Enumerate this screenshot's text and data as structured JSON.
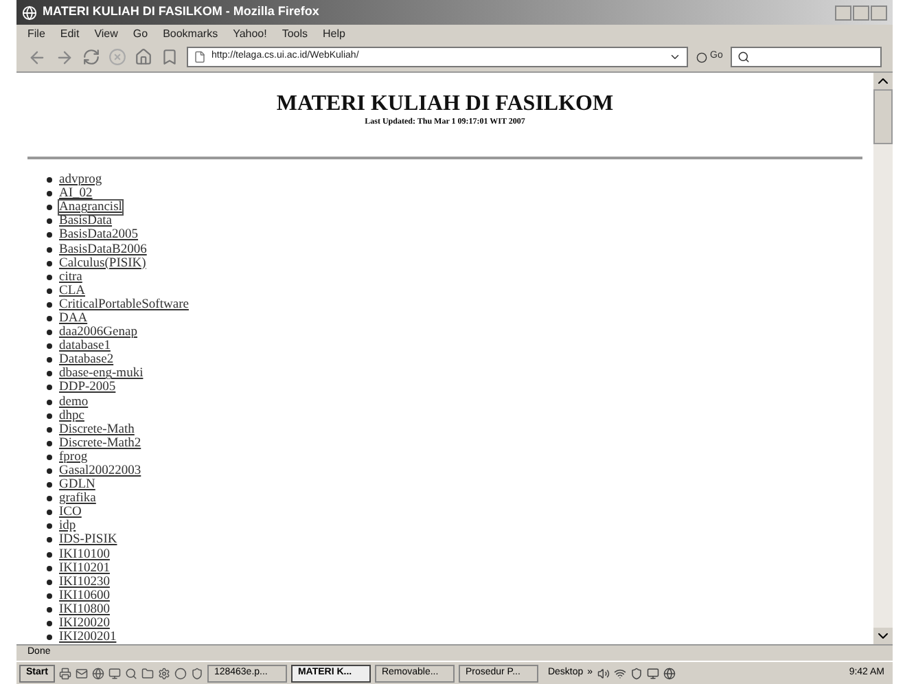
{
  "window": {
    "title": "MATERI KULIAH DI FASILKOM - Mozilla Firefox"
  },
  "menu": [
    "File",
    "Edit",
    "View",
    "Go",
    "Bookmarks",
    "Yahoo!",
    "Tools",
    "Help"
  ],
  "address": {
    "value": "http://telaga.cs.ui.ac.id/WebKuliah/"
  },
  "go_button": "Go",
  "page": {
    "heading": "MATERI KULIAH DI FASILKOM",
    "updated": "Last Updated: Thu Mar 1 09:17:01 WIT 2007",
    "links": [
      {
        "label": "advprog",
        "focused": false
      },
      {
        "label": "AI_02",
        "focused": false
      },
      {
        "label": "Anagrancisl",
        "focused": true
      },
      {
        "label": "BasisData",
        "focused": false
      },
      {
        "label": "BasisData2005",
        "focused": false
      },
      {
        "label": "BasisDataB2006",
        "focused": false
      },
      {
        "label": "Calculus(PISIK)",
        "focused": false
      },
      {
        "label": "citra",
        "focused": false
      },
      {
        "label": "CLA",
        "focused": false
      },
      {
        "label": "CriticalPortableSoftware",
        "focused": false
      },
      {
        "label": "DAA",
        "focused": false
      },
      {
        "label": "daa2006Genap",
        "focused": false
      },
      {
        "label": "database1",
        "focused": false
      },
      {
        "label": "Database2",
        "focused": false
      },
      {
        "label": "dbase-eng-muki",
        "focused": false
      },
      {
        "label": "DDP-2005",
        "focused": false
      },
      {
        "label": "demo",
        "focused": false
      },
      {
        "label": "dhpc",
        "focused": false
      },
      {
        "label": "Discrete-Math",
        "focused": false
      },
      {
        "label": "Discrete-Math2",
        "focused": false
      },
      {
        "label": "fprog",
        "focused": false
      },
      {
        "label": "Gasal20022003",
        "focused": false
      },
      {
        "label": "GDLN",
        "focused": false
      },
      {
        "label": "grafika",
        "focused": false
      },
      {
        "label": "ICO",
        "focused": false
      },
      {
        "label": "idp",
        "focused": false
      },
      {
        "label": "IDS-PISIK",
        "focused": false
      },
      {
        "label": "IKI10100",
        "focused": false
      },
      {
        "label": "IKI10201",
        "focused": false
      },
      {
        "label": "IKI10230",
        "focused": false
      },
      {
        "label": "IKI10600",
        "focused": false
      },
      {
        "label": "IKI10800",
        "focused": false
      },
      {
        "label": "IKI20020",
        "focused": false
      },
      {
        "label": "IKI200201",
        "focused": false
      }
    ]
  },
  "status_bar": "Done",
  "taskbar": {
    "start": "Start",
    "windows": [
      {
        "label": "128463e.p...",
        "selected": false
      },
      {
        "label": "MATERI K...",
        "selected": true
      },
      {
        "label": "Removable...",
        "selected": false
      },
      {
        "label": "Prosedur P...",
        "selected": false
      }
    ],
    "desktop": "Desktop",
    "chevron": "»",
    "clock": "9:42 AM"
  }
}
